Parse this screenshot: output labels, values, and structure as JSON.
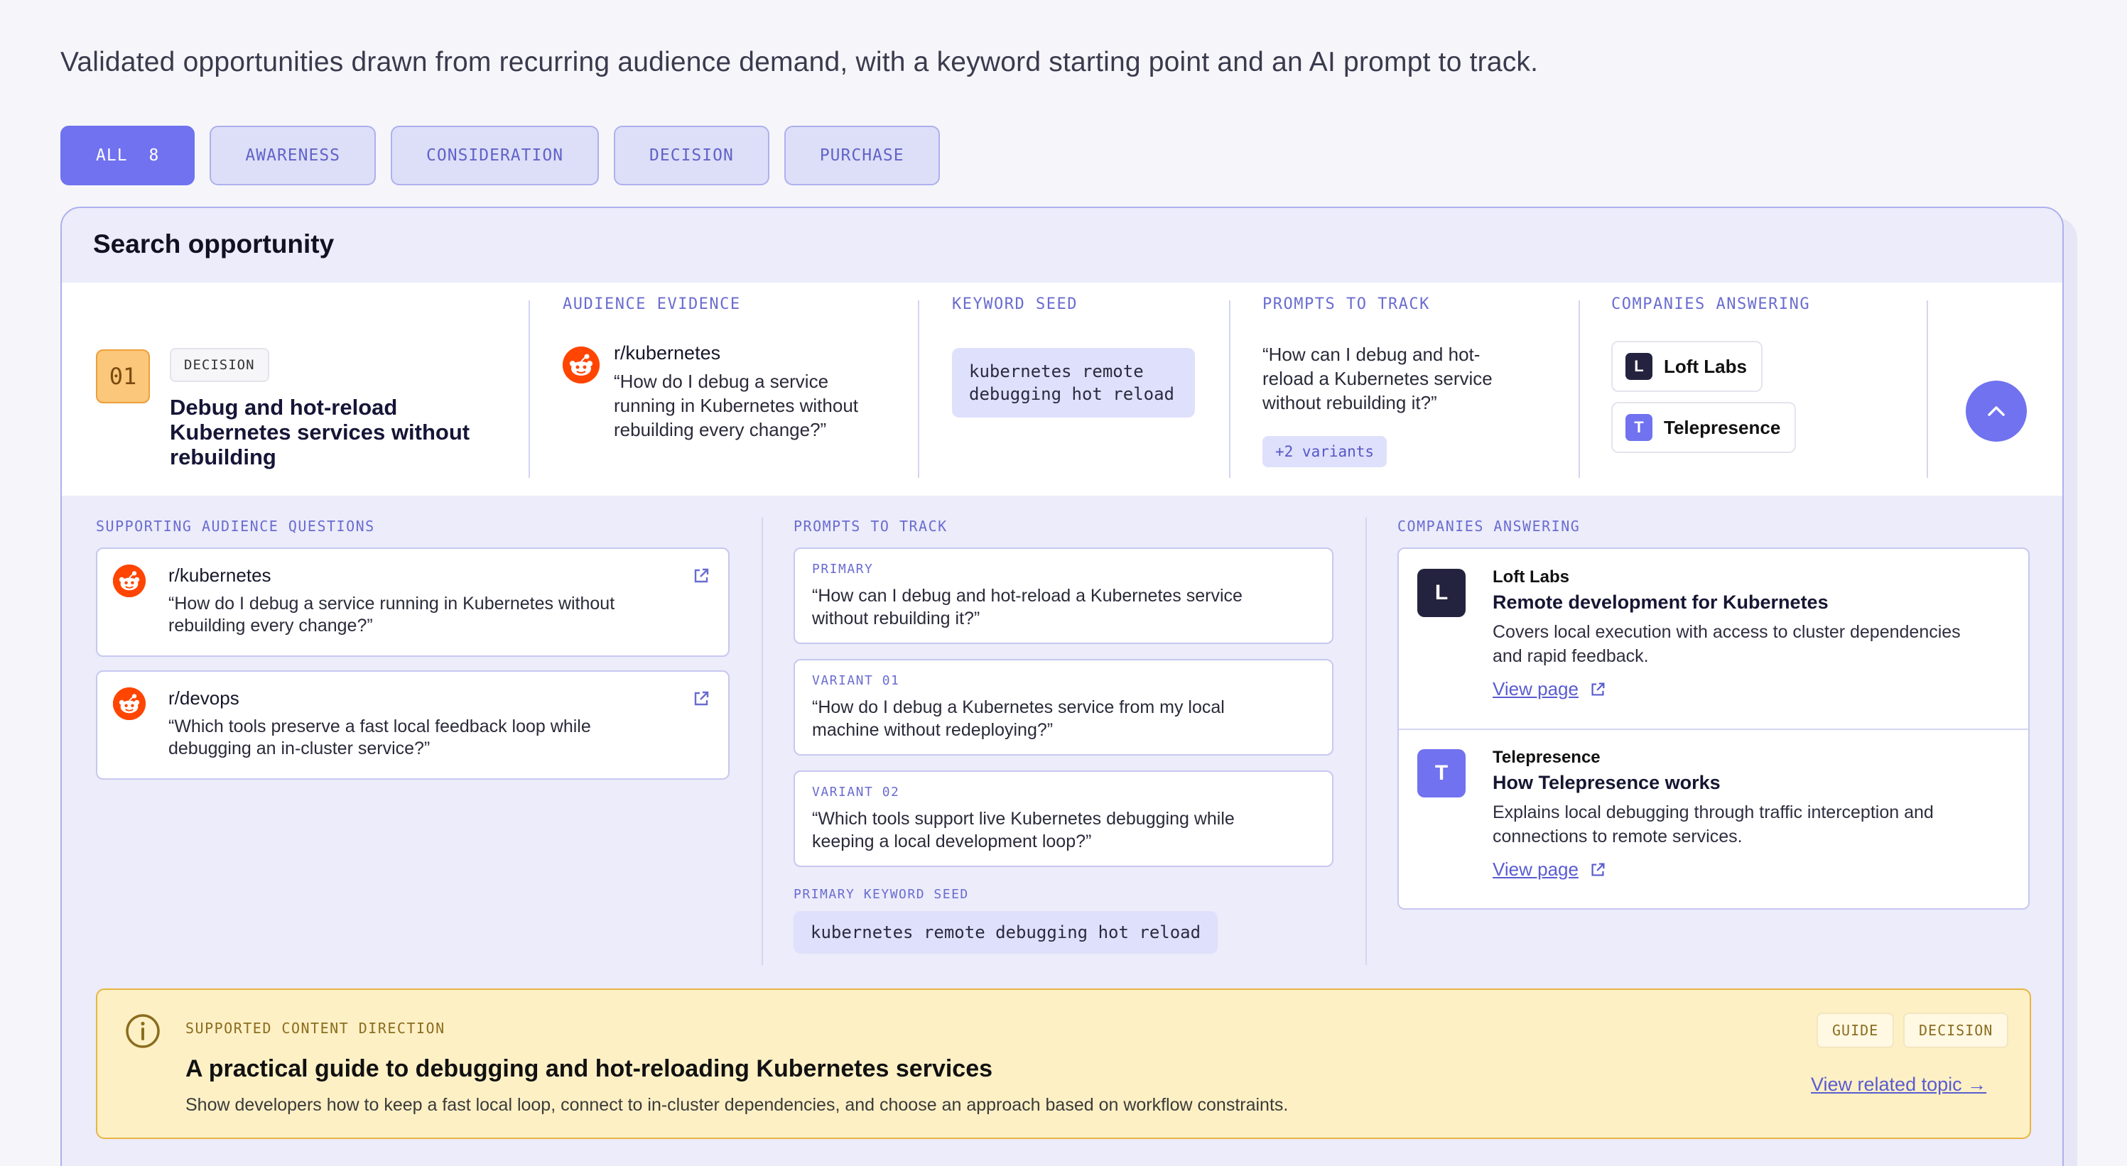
{
  "intro": "Validated opportunities drawn from recurring audience demand, with a keyword starting point and an AI prompt to track.",
  "filters": [
    {
      "label": "ALL",
      "count": "8",
      "active": true
    },
    {
      "label": "AWARENESS"
    },
    {
      "label": "CONSIDERATION"
    },
    {
      "label": "DECISION"
    },
    {
      "label": "PURCHASE"
    }
  ],
  "card": {
    "title": "Search opportunity",
    "number": "01",
    "stage": "DECISION",
    "opportunity_title": "Debug and hot-reload Kubernetes services without rebuilding",
    "audience_evidence": {
      "label": "AUDIENCE EVIDENCE",
      "subreddit": "r/kubernetes",
      "quote": "“How do I debug a service running in Kubernetes without rebuilding every change?”"
    },
    "keyword_seed": {
      "label": "KEYWORD SEED",
      "line1": "kubernetes remote",
      "line2": "debugging hot reload"
    },
    "prompts": {
      "label": "PROMPTS TO TRACK",
      "quote": "“How can I debug and hot-reload a Kubernetes service without rebuilding it?”",
      "variants": "+2 variants"
    },
    "companies": {
      "label": "COMPANIES ANSWERING",
      "items": [
        {
          "initial": "L",
          "name": "Loft Labs"
        },
        {
          "initial": "T",
          "name": "Telepresence"
        }
      ]
    }
  },
  "details": {
    "questions": {
      "label": "SUPPORTING AUDIENCE QUESTIONS",
      "items": [
        {
          "subreddit": "r/kubernetes",
          "line1": "“How do I debug a service running in Kubernetes without",
          "line2": "rebuilding every change?”"
        },
        {
          "subreddit": "r/devops",
          "line1": "“Which tools preserve a fast local feedback loop while",
          "line2": "debugging an in-cluster service?”"
        }
      ]
    },
    "prompts": {
      "label": "PROMPTS TO TRACK",
      "items": [
        {
          "tag": "PRIMARY",
          "line1": "“How can I debug and hot-reload a Kubernetes service",
          "line2": "without rebuilding it?”"
        },
        {
          "tag": "VARIANT 01",
          "line1": "“How do I debug a Kubernetes service from my local",
          "line2": "machine without redeploying?”"
        },
        {
          "tag": "VARIANT 02",
          "line1": "“Which tools support live Kubernetes debugging while",
          "line2": "keeping a local development loop?”"
        }
      ],
      "keyword_label": "PRIMARY KEYWORD SEED",
      "keyword": "kubernetes remote debugging hot reload"
    },
    "companies": {
      "label": "COMPANIES ANSWERING",
      "items": [
        {
          "initial": "L",
          "name": "Loft Labs",
          "title": "Remote development for Kubernetes",
          "line1": "Covers local execution with access to cluster dependencies",
          "line2": "and rapid feedback.",
          "link": "View page"
        },
        {
          "initial": "T",
          "name": "Telepresence",
          "title": "How Telepresence works",
          "line1": "Explains local debugging through traffic interception and",
          "line2": "connections to remote services.",
          "link": "View page"
        }
      ]
    }
  },
  "banner": {
    "label": "SUPPORTED CONTENT DIRECTION",
    "title": "A practical guide to debugging and hot-reloading Kubernetes services",
    "description": "Show developers how to keep a fast local loop, connect to in-cluster dependencies, and choose an approach based on workflow constraints.",
    "chips": [
      "GUIDE",
      "DECISION"
    ],
    "link": "View related topic →"
  },
  "colors": {
    "accent": "#7072ef",
    "reddit": "#ff4500",
    "banner_bg": "#fdf0c5",
    "badge_orange": "#fbc77a"
  }
}
